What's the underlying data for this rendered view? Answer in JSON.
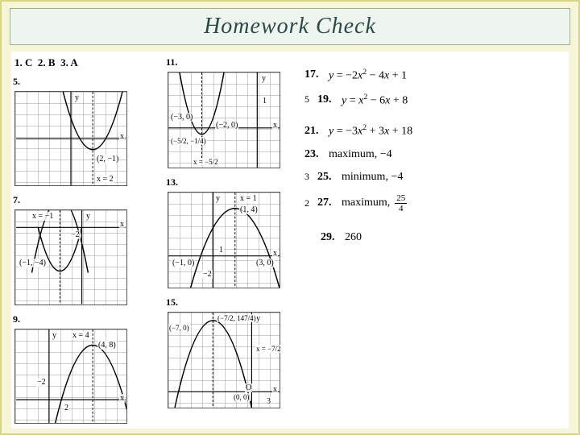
{
  "title": "Homework Check",
  "topline": {
    "a1n": "1.",
    "a1v": "C",
    "a2n": "2.",
    "a2v": "B",
    "a3n": "3.",
    "a3v": "A"
  },
  "problems": {
    "p5": {
      "num": "5.",
      "vertex": "(2, −1)",
      "axis": "x = 2",
      "y": "y",
      "x": "x"
    },
    "p7": {
      "num": "7.",
      "axis": "x = −1",
      "vertex": "(−1, −4)",
      "pt": "−2",
      "y": "y",
      "x": "x"
    },
    "p9": {
      "num": "9.",
      "axis": "x = 4",
      "vertex": "(4, 8)",
      "y": "y",
      "x": "x",
      "tick1": "−2",
      "tick2": "2"
    },
    "p11": {
      "num": "11.",
      "r1": "(−3, 0)",
      "r2": "(−2, 0)",
      "vertex": "(−5/2, −1/4)",
      "axis": "x = −5/2",
      "y": "y",
      "x": "x",
      "one": "1"
    },
    "p13": {
      "num": "13.",
      "axis": "x = 1",
      "vertex": "(1, 4)",
      "r1": "(−1, 0)",
      "r2": "(3, 0)",
      "y": "y",
      "x": "x",
      "neg2": "−2",
      "one": "1"
    },
    "p15": {
      "num": "15.",
      "r1": "(−7, 0)",
      "vertex": "(−7/2, 147/4)",
      "axis": "x = −7/2",
      "r2": "(0, 0)",
      "o": "O",
      "y": "y",
      "x": "x",
      "tick": "3"
    }
  },
  "answers": {
    "a17": {
      "n": "17.",
      "t": "y = −2x² − 4x + 1"
    },
    "a19": {
      "n": "19.",
      "t": "y = x² − 6x + 8",
      "pre": "5"
    },
    "a21": {
      "n": "21.",
      "t": "y = −3x² + 3x + 18"
    },
    "a23": {
      "n": "23.",
      "t": "maximum, −4"
    },
    "a25": {
      "n": "25.",
      "t": "minimum, −4",
      "pre": "3"
    },
    "a27": {
      "n": "27.",
      "t": "maximum,",
      "pre": "2",
      "frac_n": "25",
      "frac_d": "4"
    },
    "a29": {
      "n": "29.",
      "t": "260"
    }
  }
}
